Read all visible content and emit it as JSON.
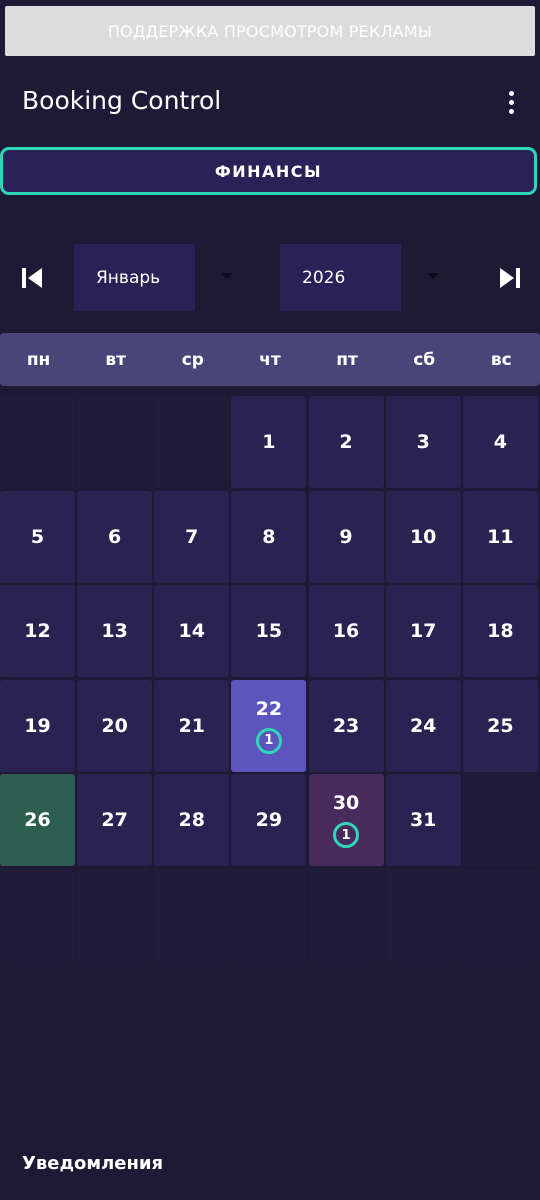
{
  "ad_banner": {
    "label": "ПОДДЕРЖКА ПРОСМОТРОМ РЕКЛАМЫ"
  },
  "header": {
    "title": "Booking Control"
  },
  "finance_button": {
    "label": "ФИНАНСЫ"
  },
  "calendar": {
    "month": "Январь",
    "year": "2026",
    "weekdays": [
      "пн",
      "вт",
      "ср",
      "чт",
      "пт",
      "сб",
      "вс"
    ],
    "weeks": [
      [
        null,
        null,
        null,
        "1",
        "2",
        "3",
        "4"
      ],
      [
        "5",
        "6",
        "7",
        "8",
        "9",
        "10",
        "11"
      ],
      [
        "12",
        "13",
        "14",
        "15",
        "16",
        "17",
        "18"
      ],
      [
        "19",
        "20",
        "21",
        "22",
        "23",
        "24",
        "25"
      ],
      [
        "26",
        "27",
        "28",
        "29",
        "30",
        "31",
        null
      ],
      [
        null,
        null,
        null,
        null,
        null,
        null,
        null
      ]
    ],
    "badges": {
      "22": "1",
      "30": "1"
    },
    "today": "22",
    "highlight_green": "26",
    "highlight_booked": "30"
  },
  "footer": {
    "notifications_title": "Уведомления"
  },
  "colors": {
    "accent": "#2ed8b6",
    "today": "#5b55bd",
    "green": "#2e5e50",
    "booked": "#472b5c"
  }
}
